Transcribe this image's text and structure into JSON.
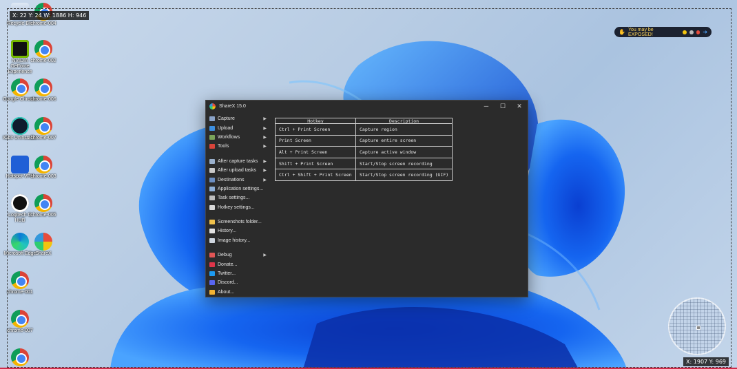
{
  "overlay": {
    "top_readout": "X: 22 Y: 24 W: 1886 H: 946",
    "bottom_readout": "X: 1907 Y: 969"
  },
  "desktop_icons": [
    {
      "label": "Recycle Bin",
      "kind": "recycle"
    },
    {
      "label": "chrome-004",
      "kind": "chrome"
    },
    {
      "label": "NVIDIA GeForce Experience",
      "kind": "nvidia"
    },
    {
      "label": "chrome-002",
      "kind": "chrome"
    },
    {
      "label": "Google Chrome",
      "kind": "chrome"
    },
    {
      "label": "chrome-006",
      "kind": "chrome"
    },
    {
      "label": "IObit Uninstaller",
      "kind": "iobit"
    },
    {
      "label": "chrome-007",
      "kind": "chrome"
    },
    {
      "label": "Hotspot VPN",
      "kind": "vpn"
    },
    {
      "label": "chrome-003",
      "kind": "chrome"
    },
    {
      "label": "Logitech G HUB",
      "kind": "logitech"
    },
    {
      "label": "chrome-005",
      "kind": "chrome"
    },
    {
      "label": "Microsoft Edge",
      "kind": "edge"
    },
    {
      "label": "ShareX",
      "kind": "sharex"
    },
    {
      "label": "chrome-001",
      "kind": "chrome"
    },
    {
      "label": "chrome-007",
      "kind": "chrome"
    },
    {
      "label": "",
      "kind": "chrome"
    }
  ],
  "notification": {
    "text": "You may be EXPOSED!"
  },
  "window": {
    "title": "ShareX 15.0",
    "controls": {
      "minimize": "─",
      "maximize": "☐",
      "close": "✕"
    }
  },
  "menu": [
    {
      "label": "Capture",
      "submenu": true,
      "icon_color": "#8aa3c8"
    },
    {
      "label": "Upload",
      "submenu": true,
      "icon_color": "#3d8fe0"
    },
    {
      "label": "Workflows",
      "submenu": true,
      "icon_color": "#7aa35a"
    },
    {
      "label": "Tools",
      "submenu": true,
      "icon_color": "#d9443a"
    },
    {
      "sep": true
    },
    {
      "label": "After capture tasks",
      "submenu": true,
      "icon_color": "#9ab0cc"
    },
    {
      "label": "After upload tasks",
      "submenu": true,
      "icon_color": "#c9c9c9"
    },
    {
      "label": "Destinations",
      "submenu": true,
      "icon_color": "#6b8ec2"
    },
    {
      "label": "Application settings...",
      "submenu": false,
      "icon_color": "#8fb0d8"
    },
    {
      "label": "Task settings...",
      "submenu": false,
      "icon_color": "#bdbdbd"
    },
    {
      "label": "Hotkey settings...",
      "submenu": false,
      "icon_color": "#d8d8d8"
    },
    {
      "sep": true
    },
    {
      "label": "Screenshots folder...",
      "submenu": false,
      "icon_color": "#f0c14b"
    },
    {
      "label": "History...",
      "submenu": false,
      "icon_color": "#e3e3e3"
    },
    {
      "label": "Image history...",
      "submenu": false,
      "icon_color": "#cfd6df"
    },
    {
      "sep": true
    },
    {
      "label": "Debug",
      "submenu": true,
      "icon_color": "#e25555"
    },
    {
      "label": "Donate...",
      "submenu": false,
      "icon_color": "#e0354a"
    },
    {
      "label": "Twitter...",
      "submenu": false,
      "icon_color": "#1d9bf0"
    },
    {
      "label": "Discord...",
      "submenu": false,
      "icon_color": "#5865f2"
    },
    {
      "label": "About...",
      "submenu": false,
      "icon_color": "#f2b233"
    }
  ],
  "hotkeys": {
    "headers": [
      "Hotkey",
      "Description"
    ],
    "rows": [
      [
        "Ctrl + Print Screen",
        "Capture region"
      ],
      [
        "Print Screen",
        "Capture entire screen"
      ],
      [
        "Alt + Print Screen",
        "Capture active window"
      ],
      [
        "Shift + Print Screen",
        "Start/Stop screen recording"
      ],
      [
        "Ctrl + Shift + Print Screen",
        "Start/Stop screen recording (GIF)"
      ]
    ]
  }
}
